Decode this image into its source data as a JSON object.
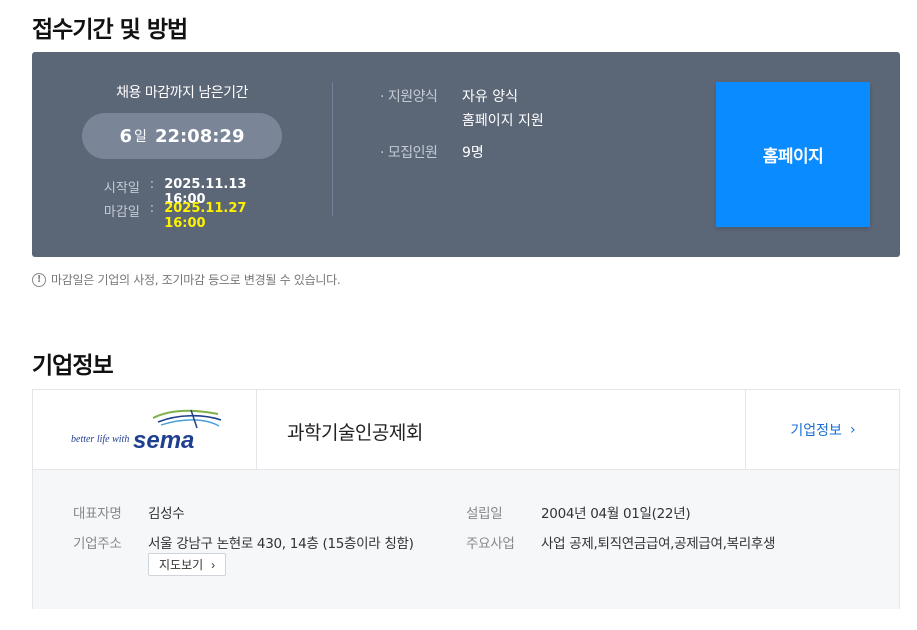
{
  "section_application": {
    "title": "접수기간 및 방법",
    "deadline_label": "채용 마감까지 남은기간",
    "countdown": {
      "days": "6",
      "days_unit": "일",
      "time": "22:08:29"
    },
    "start": {
      "label": "시작일",
      "colon": ":",
      "value": "2025.11.13 16:00"
    },
    "end": {
      "label": "마감일",
      "colon": ":",
      "value": "2025.11.27 16:00"
    },
    "apply_method": {
      "label": "· 지원양식",
      "values": [
        "자유 양식",
        "홈페이지 지원"
      ]
    },
    "openings": {
      "label": "· 모집인원",
      "value": "9명"
    },
    "homepage_button": "홈페이지",
    "notice_icon": "!",
    "notice": "마감일은 기업의 사정, 조기마감 등으로 변경될 수 있습니다."
  },
  "section_company": {
    "title": "기업정보",
    "logo": {
      "tagline": "better life with",
      "brand": "sema"
    },
    "name": "과학기술인공제회",
    "more_link": "기업정보",
    "more_chevron": "›",
    "ceo": {
      "label": "대표자명",
      "value": "김성수"
    },
    "address": {
      "label": "기업주소",
      "value": "서울 강남구 논현로 430, 14층 (15층이라 칭함)"
    },
    "map_button": "지도보기",
    "map_chevron": "›",
    "founded": {
      "label": "설립일",
      "value": "2004년 04월 01일(22년)"
    },
    "business": {
      "label": "주요사업",
      "value": "사업 공제,퇴직연금급여,공제급여,복리후생"
    }
  },
  "colors": {
    "panel": "#5b6677",
    "countdown_pill": "#7a8698",
    "primary_button": "#0a8bff",
    "deadline_highlight": "#fff200",
    "link": "#1a6fd6"
  }
}
